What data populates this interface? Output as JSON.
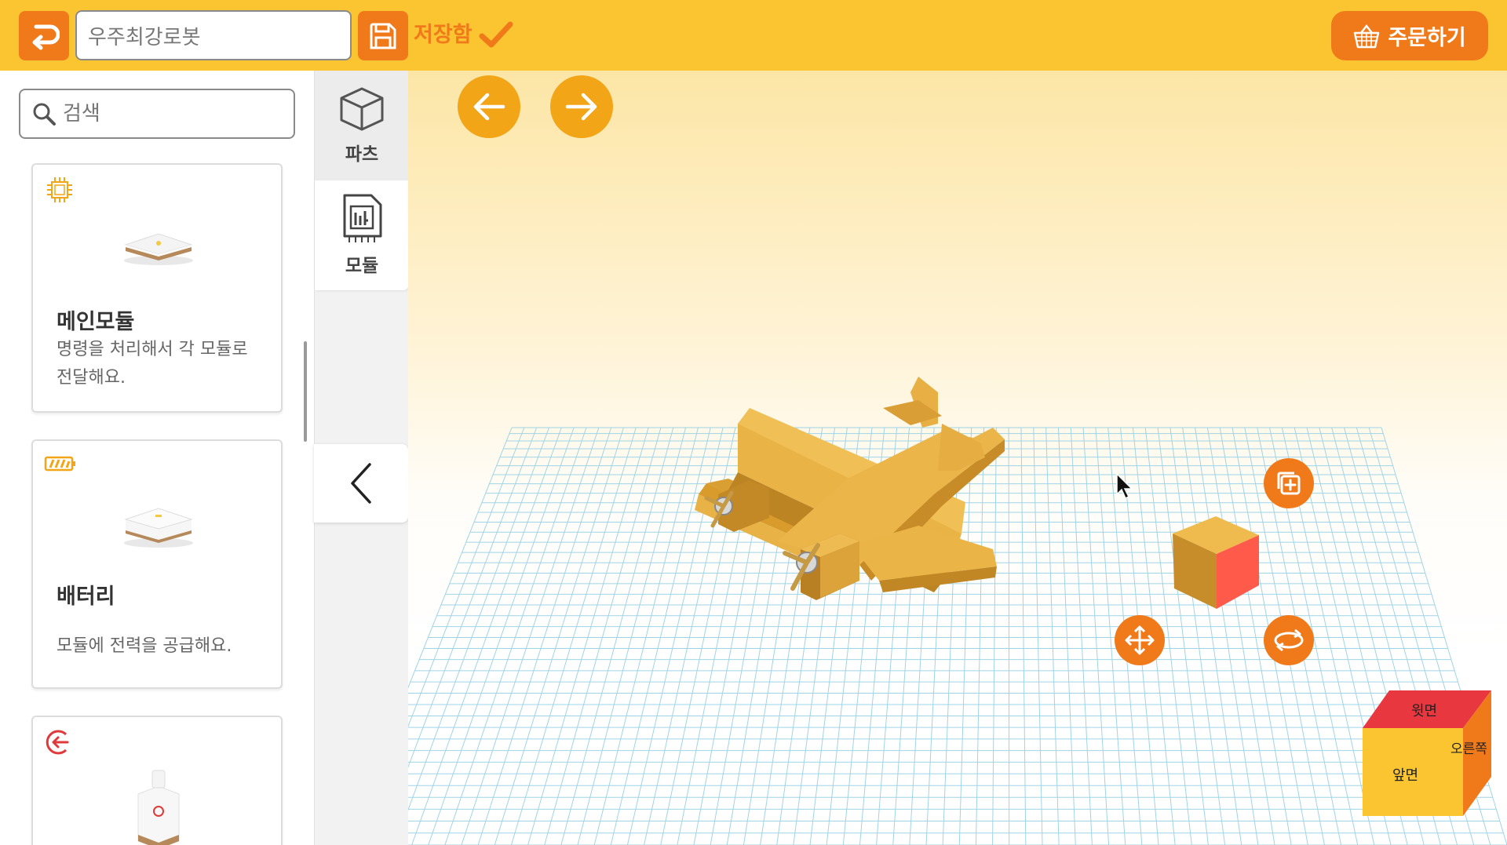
{
  "header": {
    "project_name": "우주최강로봇",
    "save_status": "저장함",
    "order_label": "주문하기"
  },
  "search": {
    "placeholder": "검색"
  },
  "tabs": {
    "parts_label": "파츠",
    "modules_label": "모듈"
  },
  "modules": [
    {
      "title": "메인모듈",
      "description": "명령을 처리해서 각 모듈로 전달해요.",
      "icon": "cpu-icon"
    },
    {
      "title": "배터리",
      "description": "모듈에 전력을 공급해요.",
      "icon": "battery-icon"
    },
    {
      "title": "",
      "description": "",
      "icon": "exit-icon"
    }
  ],
  "view_cube": {
    "top": "윗면",
    "front": "앞면",
    "right": "오른쪽"
  },
  "colors": {
    "topbar": "#fbc531",
    "accent_orange": "#f07a1a",
    "nav_button": "#f2a516",
    "model_wood": "#e8ae3a",
    "selected_face": "#ff5a4a",
    "grid_line": "#9fd4e6"
  }
}
